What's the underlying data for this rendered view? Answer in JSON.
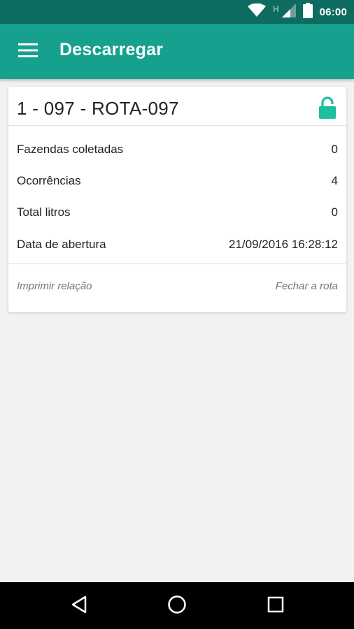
{
  "status_bar": {
    "network_type": "H",
    "time": "06:00",
    "icons": [
      "wifi-icon",
      "signal-icon",
      "battery-icon"
    ]
  },
  "app_bar": {
    "title": "Descarregar",
    "menu_icon": "hamburger-menu-icon",
    "color": "#16a08e"
  },
  "route_card": {
    "title": "1 - 097 - ROTA-097",
    "lock_icon": "unlocked-padlock-icon",
    "lock_color": "#1cbf9e",
    "rows": [
      {
        "label": "Fazendas coletadas",
        "value": "0"
      },
      {
        "label": "Ocorrências",
        "value": "4"
      },
      {
        "label": "Total litros",
        "value": "0"
      },
      {
        "label": "Data de abertura",
        "value": "21/09/2016 16:28:12"
      }
    ],
    "actions": {
      "print_label": "Imprimir relação",
      "close_label": "Fechar a rota"
    }
  },
  "nav_bar": {
    "buttons": [
      "back-icon",
      "home-icon",
      "recents-icon"
    ]
  }
}
